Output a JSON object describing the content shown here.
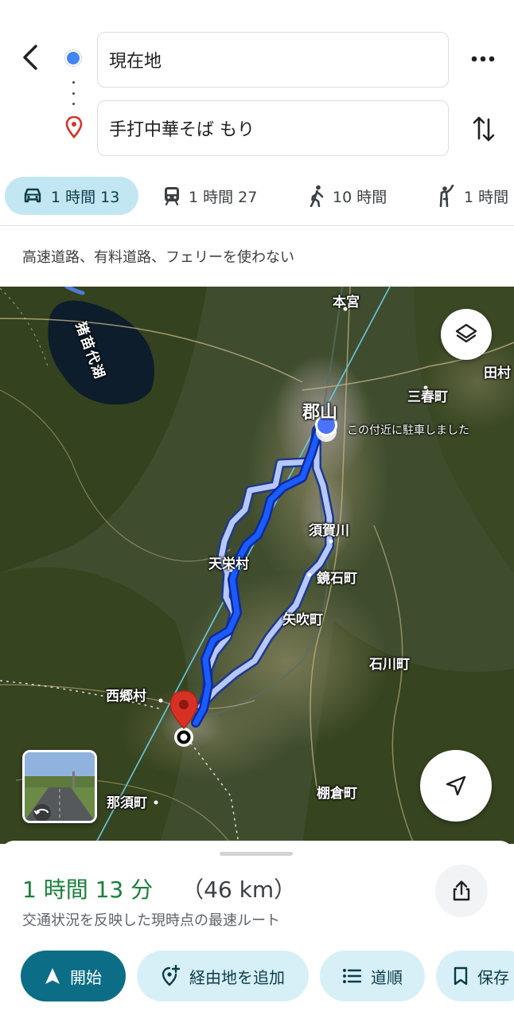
{
  "search": {
    "origin": "現在地",
    "destination": "手打中華そば もり"
  },
  "modes": [
    {
      "id": "drive",
      "icon": "car-icon",
      "time": "1 時間 13",
      "active": true
    },
    {
      "id": "transit",
      "icon": "train-icon",
      "time": "1 時間 27",
      "active": false
    },
    {
      "id": "walk",
      "icon": "walk-icon",
      "time": "10 時間",
      "active": false
    },
    {
      "id": "ride",
      "icon": "hail-icon",
      "time": "1 時間",
      "active": false
    }
  ],
  "options_note": "高速道路、有料道路、フェリーを使わない",
  "map": {
    "style": "satellite",
    "labels": {
      "motomiya": "本宮",
      "inawashiro": "猪苗代湖",
      "tamura": "田村",
      "miharu": "三春町",
      "koriyama": "郡山",
      "parked": "この付近に駐車しました",
      "sukagawa": "須賀川",
      "tenei": "天栄村",
      "kagamiishi": "鏡石町",
      "yabuki": "矢吹町",
      "ishikawa": "石川町",
      "nishigo": "西郷村",
      "nasu": "那須町",
      "tanagura": "棚倉町"
    },
    "colors": {
      "route_primary": "#1a5cff",
      "route_alt": "#b8c8ff",
      "pin": "#d93025"
    }
  },
  "sheet": {
    "duration": "1 時間 13 分",
    "distance": "（46 km）",
    "note": "交通状況を反映した現時点の最速ルート",
    "buttons": {
      "start": "開始",
      "add_stop": "経由地を追加",
      "steps": "道順",
      "save": "保存"
    }
  }
}
